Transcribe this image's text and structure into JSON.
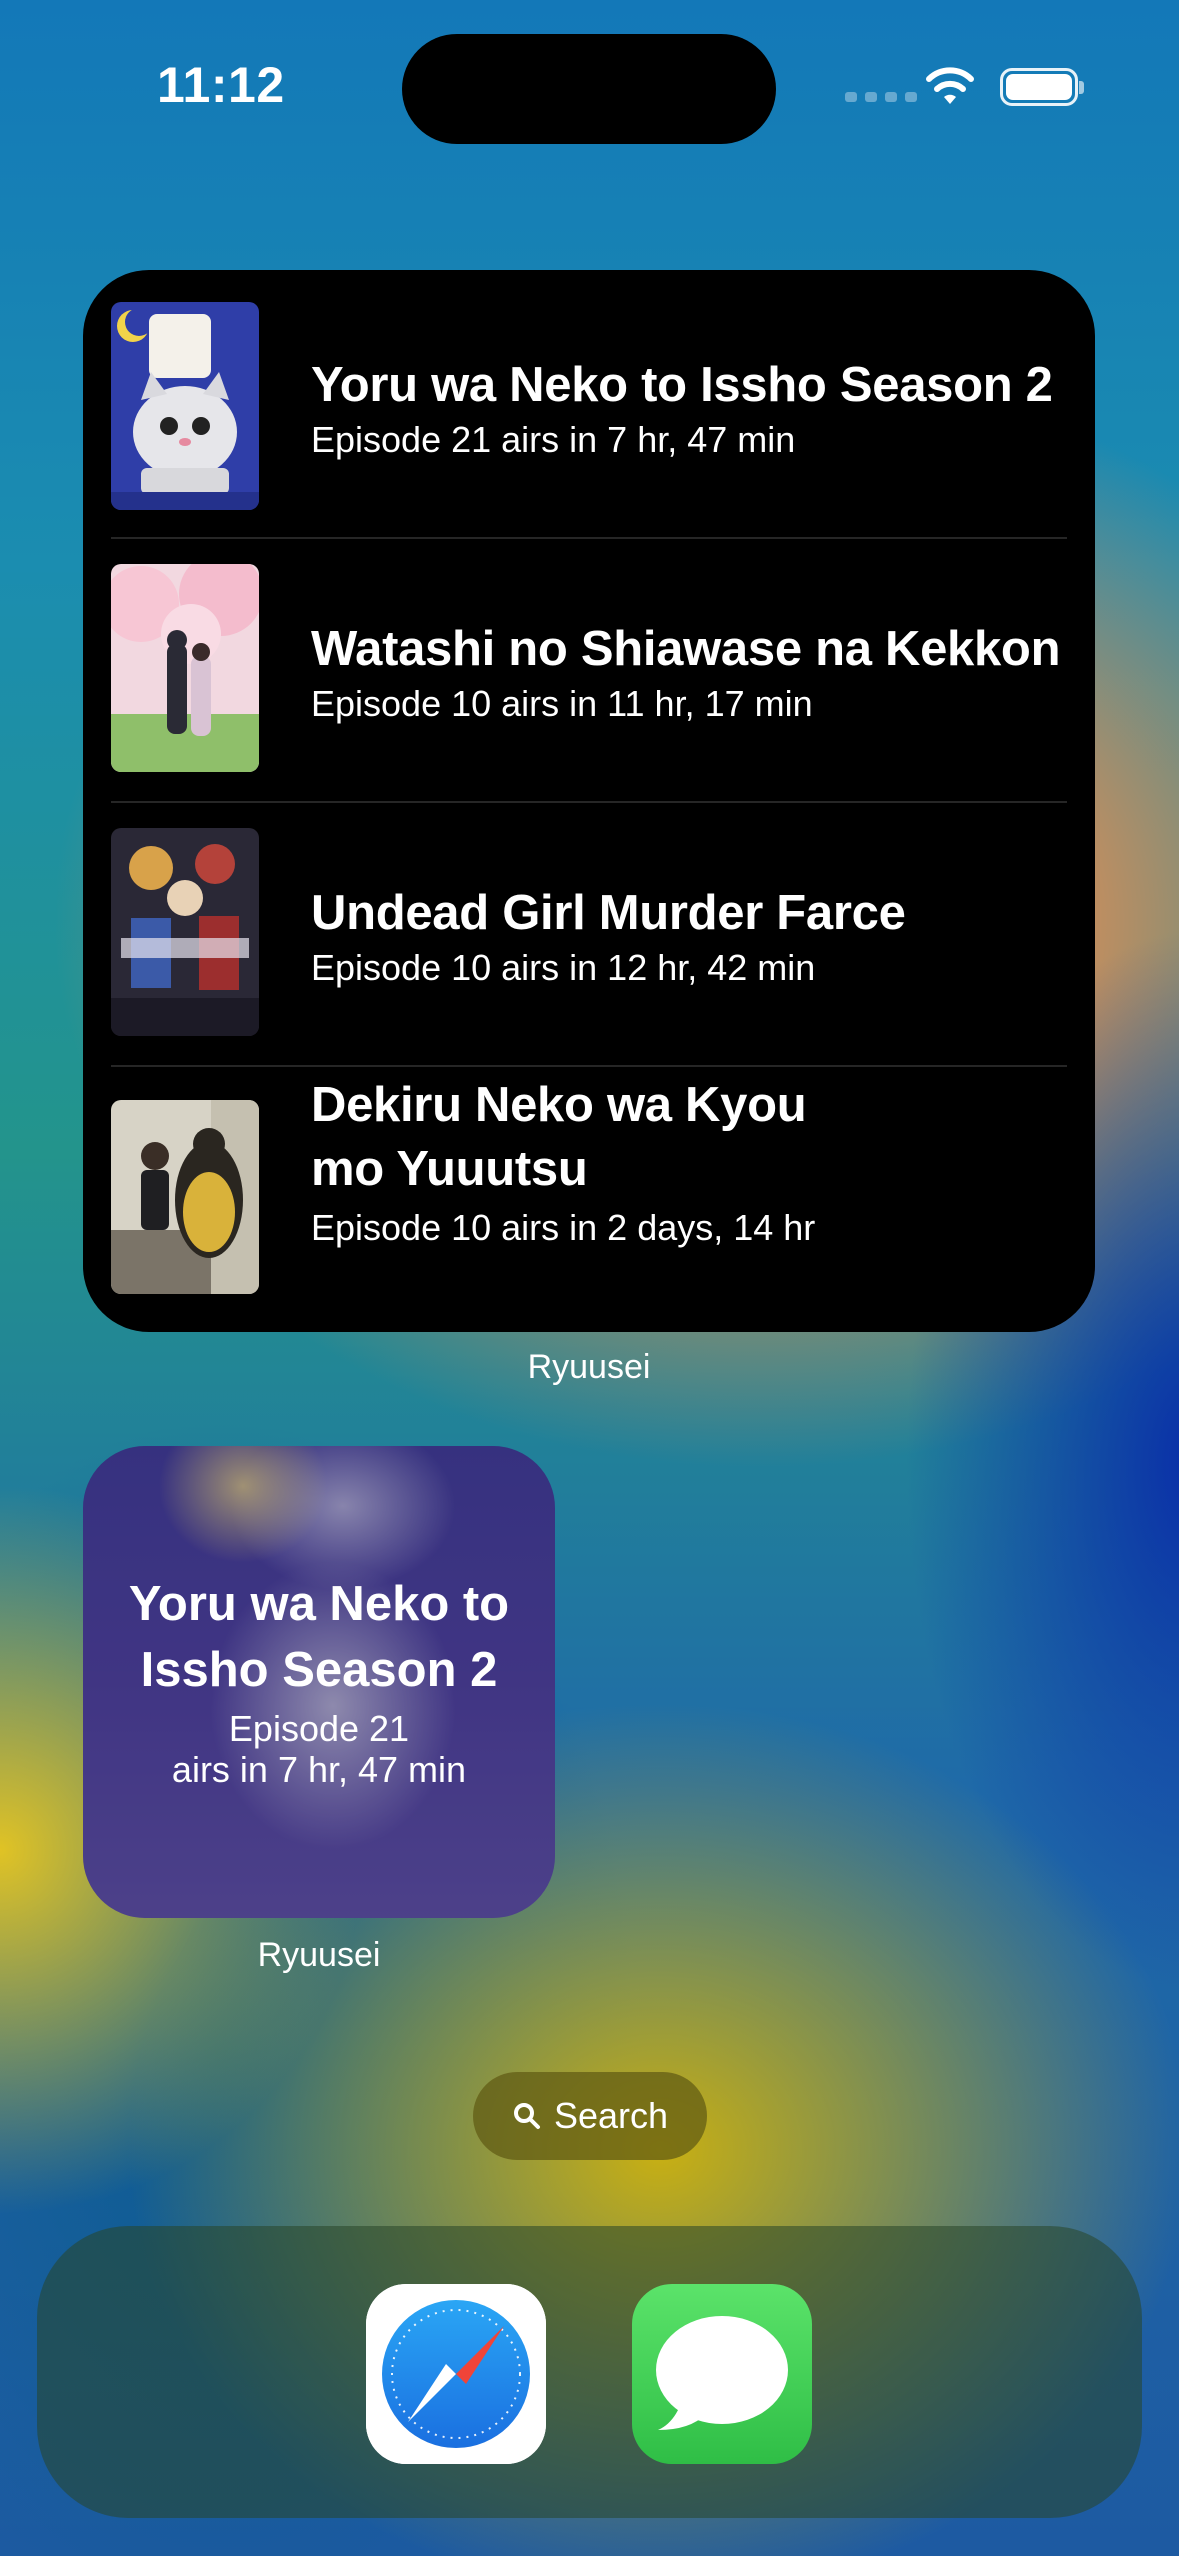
{
  "status_bar": {
    "time": "11:12"
  },
  "large_widget": {
    "items": [
      {
        "title": "Yoru wa Neko to Issho Season 2",
        "subtitle": "Episode 21 airs in 7 hr, 47 min"
      },
      {
        "title": "Watashi no Shiawase na Kekkon",
        "subtitle": "Episode 10 airs in 11 hr, 17 min"
      },
      {
        "title": "Undead Girl Murder Farce",
        "subtitle": "Episode 10 airs in 12 hr, 42 min"
      },
      {
        "title_line1": "Dekiru Neko wa Kyou",
        "title_line2": "mo Yuuutsu",
        "subtitle": "Episode 10 airs in 2 days, 14 hr"
      }
    ],
    "caption": "Ryuusei"
  },
  "small_widget": {
    "title_line1": "Yoru wa Neko to",
    "title_line2": "Issho Season 2",
    "subtitle_line1": "Episode 21",
    "subtitle_line2": "airs in 7 hr, 47 min",
    "caption": "Ryuusei"
  },
  "search": {
    "label": "Search",
    "icon": "magnifying-glass"
  },
  "dock": {
    "apps": [
      "Safari",
      "Messages"
    ]
  },
  "colors": {
    "widget_bg": "#000000",
    "messages_green": "#34c759",
    "safari_blue": "#1e8bf0"
  }
}
